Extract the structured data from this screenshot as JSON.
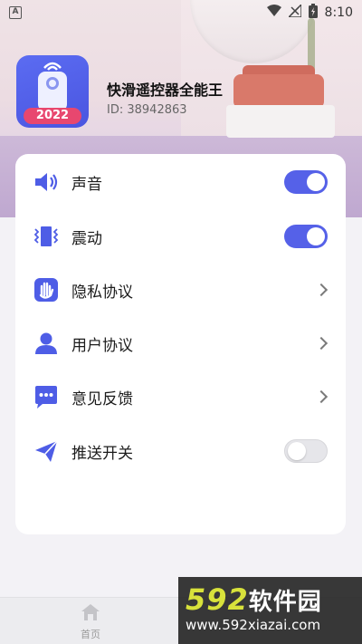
{
  "status_bar": {
    "notification_badge": "A",
    "time": "8:10",
    "icons": [
      "wifi-icon",
      "signal-icon",
      "battery-charging-icon"
    ]
  },
  "app": {
    "name": "快滑遥控器全能王",
    "id_text": "ID: 38942863",
    "icon_badge": "2022"
  },
  "settings": {
    "items": [
      {
        "label": "声音",
        "icon": "speaker-icon",
        "control": "toggle",
        "on": true
      },
      {
        "label": "震动",
        "icon": "vibration-icon",
        "control": "toggle",
        "on": true
      },
      {
        "label": "隐私协议",
        "icon": "hand-icon",
        "control": "chevron"
      },
      {
        "label": "用户协议",
        "icon": "user-icon",
        "control": "chevron"
      },
      {
        "label": "意见反馈",
        "icon": "chat-bubble-icon",
        "control": "chevron"
      },
      {
        "label": "推送开关",
        "icon": "send-icon",
        "control": "toggle",
        "on": false
      }
    ]
  },
  "tabbar": {
    "home_label": "首页"
  },
  "watermark": {
    "brand_number": "592",
    "brand_text": "软件园",
    "url": "www.592xiazai.com"
  },
  "colors": {
    "accent": "#5561e8",
    "icon_blue": "#4e5de6",
    "toggle_off": "#e6e6ea",
    "card_bg": "#ffffff"
  }
}
